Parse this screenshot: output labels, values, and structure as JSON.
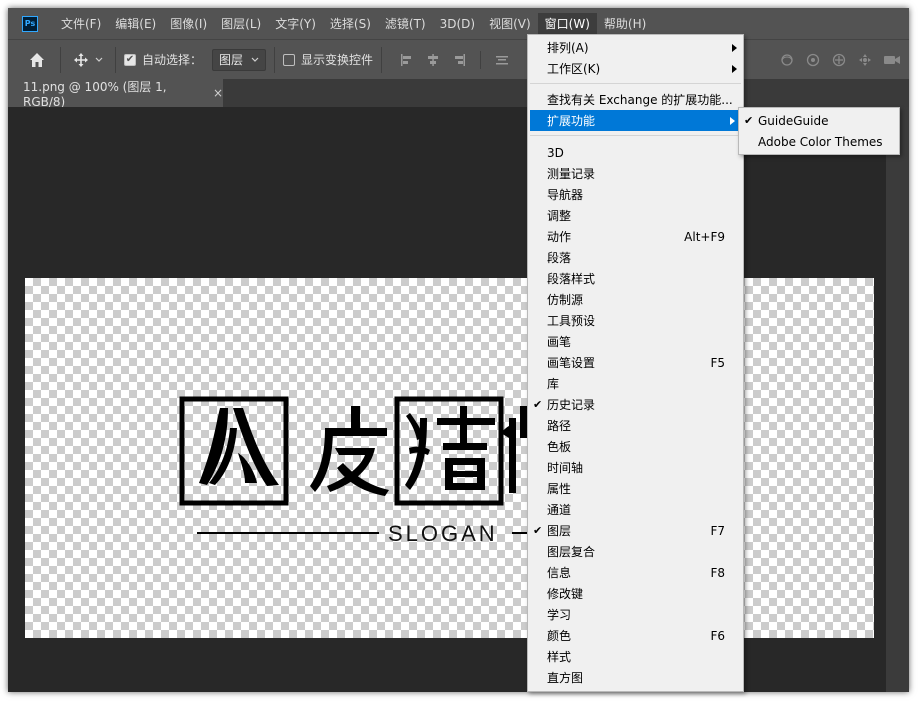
{
  "app": {
    "logo_text": "Ps"
  },
  "menubar": {
    "items": [
      "文件(F)",
      "编辑(E)",
      "图像(I)",
      "图层(L)",
      "文字(Y)",
      "选择(S)",
      "滤镜(T)",
      "3D(D)",
      "视图(V)",
      "窗口(W)",
      "帮助(H)"
    ],
    "active_index": 9
  },
  "options": {
    "auto_select_label": "自动选择：",
    "auto_select_checked": true,
    "target_value": "图层",
    "show_transform_label": "显示变换控件",
    "show_transform_checked": false
  },
  "tab": {
    "title": "11.png @ 100% (图层 1, RGB/8)",
    "close": "×"
  },
  "canvas": {
    "slogan": "SLOGAN"
  },
  "window_menu": {
    "group1": [
      {
        "label": "排列(A)",
        "submenu": true
      },
      {
        "label": "工作区(K)",
        "submenu": true
      }
    ],
    "group2": [
      {
        "label": "查找有关 Exchange 的扩展功能..."
      },
      {
        "label": "扩展功能",
        "submenu": true,
        "highlighted": true
      }
    ],
    "group3": [
      {
        "label": "3D"
      },
      {
        "label": "测量记录"
      },
      {
        "label": "导航器"
      },
      {
        "label": "调整"
      },
      {
        "label": "动作",
        "shortcut": "Alt+F9"
      },
      {
        "label": "段落"
      },
      {
        "label": "段落样式"
      },
      {
        "label": "仿制源"
      },
      {
        "label": "工具预设"
      },
      {
        "label": "画笔"
      },
      {
        "label": "画笔设置",
        "shortcut": "F5"
      },
      {
        "label": "库"
      },
      {
        "label": "历史记录",
        "checked": true
      },
      {
        "label": "路径"
      },
      {
        "label": "色板"
      },
      {
        "label": "时间轴"
      },
      {
        "label": "属性"
      },
      {
        "label": "通道"
      },
      {
        "label": "图层",
        "shortcut": "F7",
        "checked": true
      },
      {
        "label": "图层复合"
      },
      {
        "label": "信息",
        "shortcut": "F8"
      },
      {
        "label": "修改键"
      },
      {
        "label": "学习"
      },
      {
        "label": "颜色",
        "shortcut": "F6"
      },
      {
        "label": "样式"
      },
      {
        "label": "直方图"
      }
    ]
  },
  "extensions_submenu": [
    {
      "label": "GuideGuide",
      "checked": true
    },
    {
      "label": "Adobe Color Themes"
    }
  ],
  "check_mark": "✔"
}
